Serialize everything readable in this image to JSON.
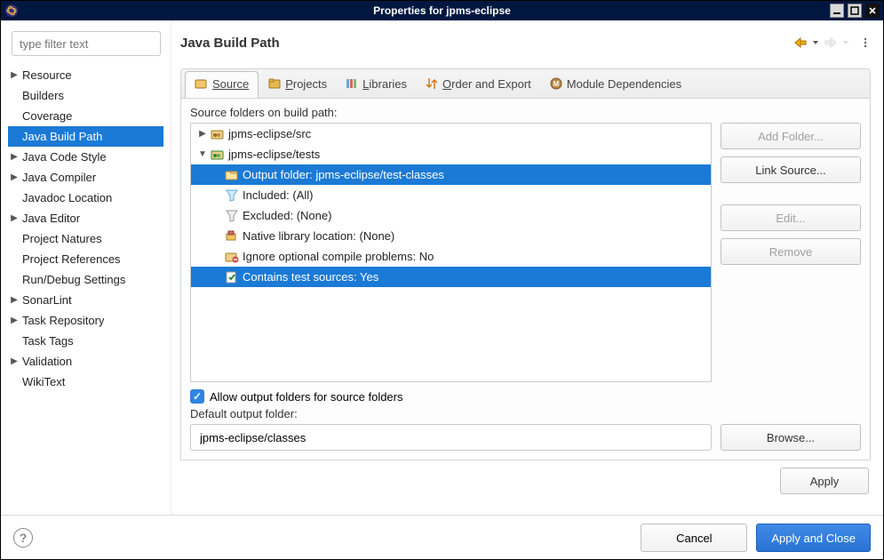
{
  "window": {
    "title": "Properties for jpms-eclipse"
  },
  "sidebar": {
    "filter_placeholder": "type filter text",
    "items": [
      {
        "label": "Resource",
        "expandable": true,
        "selected": false
      },
      {
        "label": "Builders",
        "expandable": false,
        "selected": false
      },
      {
        "label": "Coverage",
        "expandable": false,
        "selected": false
      },
      {
        "label": "Java Build Path",
        "expandable": false,
        "selected": true
      },
      {
        "label": "Java Code Style",
        "expandable": true,
        "selected": false
      },
      {
        "label": "Java Compiler",
        "expandable": true,
        "selected": false
      },
      {
        "label": "Javadoc Location",
        "expandable": false,
        "selected": false
      },
      {
        "label": "Java Editor",
        "expandable": true,
        "selected": false
      },
      {
        "label": "Project Natures",
        "expandable": false,
        "selected": false
      },
      {
        "label": "Project References",
        "expandable": false,
        "selected": false
      },
      {
        "label": "Run/Debug Settings",
        "expandable": false,
        "selected": false
      },
      {
        "label": "SonarLint",
        "expandable": true,
        "selected": false
      },
      {
        "label": "Task Repository",
        "expandable": true,
        "selected": false
      },
      {
        "label": "Task Tags",
        "expandable": false,
        "selected": false
      },
      {
        "label": "Validation",
        "expandable": true,
        "selected": false
      },
      {
        "label": "WikiText",
        "expandable": false,
        "selected": false
      }
    ]
  },
  "main": {
    "title": "Java Build Path",
    "tabs": {
      "source": "Source",
      "projects": "Projects",
      "libraries": "Libraries",
      "order": "Order and Export",
      "module": "Module Dependencies"
    },
    "section_label": "Source folders on build path:",
    "tree": {
      "root1": "jpms-eclipse/src",
      "root2": "jpms-eclipse/tests",
      "children": {
        "output": "Output folder: jpms-eclipse/test-classes",
        "included": "Included: (All)",
        "excluded": "Excluded: (None)",
        "native": "Native library location: (None)",
        "ignore": "Ignore optional compile problems: No",
        "tests": "Contains test sources: Yes"
      }
    },
    "allow_output_label": "Allow output folders for source folders",
    "default_output_label": "Default output folder:",
    "default_output_value": "jpms-eclipse/classes",
    "buttons": {
      "add_folder": "Add Folder...",
      "link_source": "Link Source...",
      "edit": "Edit...",
      "remove": "Remove",
      "browse": "Browse...",
      "apply": "Apply"
    }
  },
  "footer": {
    "cancel": "Cancel",
    "apply_close": "Apply and Close"
  }
}
